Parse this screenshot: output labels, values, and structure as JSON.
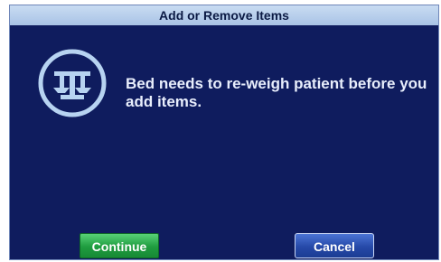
{
  "dialog": {
    "title": "Add or Remove Items",
    "icon": "scale-icon",
    "message": "Bed needs to re-weigh patient before you add items."
  },
  "buttons": {
    "continue_label": "Continue",
    "cancel_label": "Cancel"
  },
  "colors": {
    "dialog_background": "#0f1c5e",
    "title_bar": "#b8cfee",
    "continue_button": "#22a546",
    "cancel_button": "#2a4fb0"
  }
}
